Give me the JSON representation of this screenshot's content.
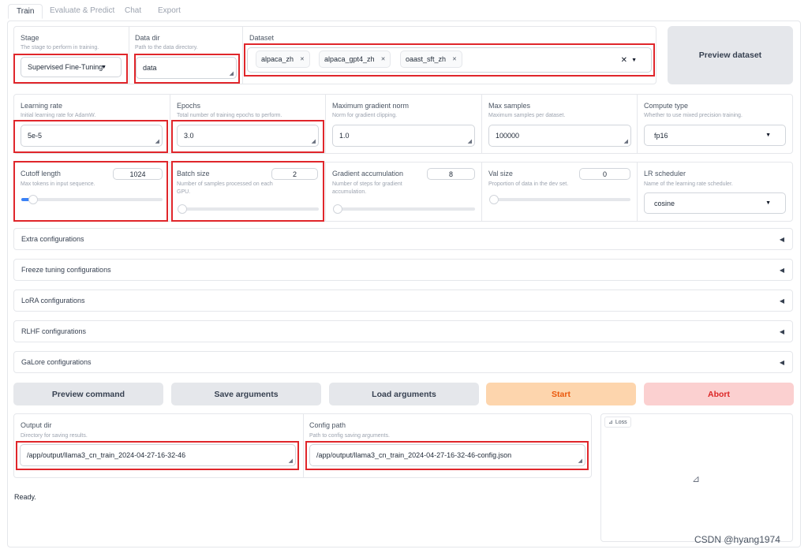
{
  "tabs": [
    "Train",
    "Evaluate & Predict",
    "Chat",
    "Export"
  ],
  "stage": {
    "label": "Stage",
    "info": "The stage to perform in training.",
    "value": "Supervised Fine-Tuning"
  },
  "data_dir": {
    "label": "Data dir",
    "info": "Path to the data directory.",
    "value": "data"
  },
  "dataset": {
    "label": "Dataset",
    "chips": [
      "alpaca_zh",
      "alpaca_gpt4_zh",
      "oaast_sft_zh"
    ]
  },
  "preview_dataset": "Preview dataset",
  "learning_rate": {
    "label": "Learning rate",
    "info": "Initial learning rate for AdamW.",
    "value": "5e-5"
  },
  "epochs": {
    "label": "Epochs",
    "info": "Total number of training epochs to perform.",
    "value": "3.0"
  },
  "max_grad_norm": {
    "label": "Maximum gradient norm",
    "info": "Norm for gradient clipping.",
    "value": "1.0"
  },
  "max_samples": {
    "label": "Max samples",
    "info": "Maximum samples per dataset.",
    "value": "100000"
  },
  "compute_type": {
    "label": "Compute type",
    "info": "Whether to use mixed precision training.",
    "value": "fp16"
  },
  "cutoff_len": {
    "label": "Cutoff length",
    "info": "Max tokens in input sequence.",
    "value": "1024",
    "slider_fraction": 0.06
  },
  "batch_size": {
    "label": "Batch size",
    "info": "Number of samples processed on each GPU.",
    "value": "2",
    "slider_fraction": 0.0
  },
  "grad_accum": {
    "label": "Gradient accumulation",
    "info": "Number of steps for gradient accumulation.",
    "value": "8",
    "slider_fraction": 0.0
  },
  "val_size": {
    "label": "Val size",
    "info": "Proportion of data in the dev set.",
    "value": "0",
    "slider_fraction": 0.0
  },
  "lr_scheduler": {
    "label": "LR scheduler",
    "info": "Name of the learning rate scheduler.",
    "value": "cosine"
  },
  "accordions": [
    "Extra configurations",
    "Freeze tuning configurations",
    "LoRA configurations",
    "RLHF configurations",
    "GaLore configurations"
  ],
  "buttons": {
    "preview_command": "Preview command",
    "save_args": "Save arguments",
    "load_args": "Load arguments",
    "start": "Start",
    "abort": "Abort"
  },
  "output_dir": {
    "label": "Output dir",
    "info": "Directory for saving results.",
    "value": "/app/output/llama3_cn_train_2024-04-27-16-32-46"
  },
  "config_path": {
    "label": "Config path",
    "info": "Path to config saving arguments.",
    "value": "/app/output/llama3_cn_train_2024-04-27-16-32-46-config.json"
  },
  "status": "Ready.",
  "loss_label": "Loss",
  "watermark": "CSDN @hyang1974",
  "colors": {
    "start_bg": "#fdd5ad",
    "start_fg": "#ea580c",
    "abort_bg": "#fbd0d0",
    "abort_fg": "#dc2626",
    "highlight": "#e0262b",
    "accent": "#3b82f6"
  }
}
